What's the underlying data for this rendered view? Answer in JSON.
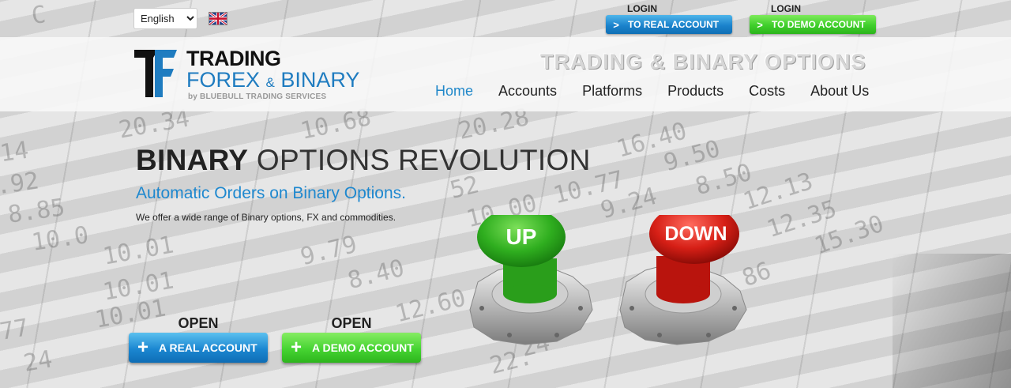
{
  "top_bar": {
    "language": {
      "selected": "English",
      "options": [
        "English"
      ]
    },
    "flag_icon": "uk-flag-icon",
    "login_real": {
      "caption": "LOGIN",
      "label": "TO REAL ACCOUNT",
      "color": "#1b83cc"
    },
    "login_demo": {
      "caption": "LOGIN",
      "label": "TO DEMO ACCOUNT",
      "color": "#3fcf2b"
    }
  },
  "header": {
    "logo": {
      "line1": "TRADING",
      "line2_main": "FOREX",
      "line2_amp": "&",
      "line2_end": "BINARY",
      "line3": "by BLUEBULL TRADING SERVICES"
    },
    "tagline": "TRADING & BINARY OPTIONS",
    "nav": [
      {
        "label": "Home",
        "active": true
      },
      {
        "label": "Accounts",
        "active": false
      },
      {
        "label": "Platforms",
        "active": false
      },
      {
        "label": "Products",
        "active": false
      },
      {
        "label": "Costs",
        "active": false
      },
      {
        "label": "About Us",
        "active": false
      }
    ],
    "accent_color": "#1f87c9"
  },
  "hero": {
    "title_bold": "BINARY",
    "title_rest": " OPTIONS REVOLUTION",
    "subtitle": "Automatic Orders on Binary Options.",
    "description": "We offer a wide range of Binary options, FX and commodities.",
    "open_real": {
      "caption": "OPEN",
      "label": "A REAL ACCOUNT"
    },
    "open_demo": {
      "caption": "OPEN",
      "label": "A DEMO ACCOUNT"
    },
    "up_button_label": "UP",
    "down_button_label": "DOWN"
  }
}
